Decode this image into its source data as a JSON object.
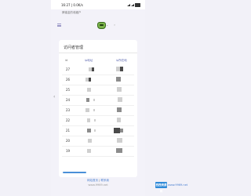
{
  "status": {
    "time": "16:27 | 0.0K/s"
  },
  "page": {
    "mini_title": "蜂蜜金的收藏户"
  },
  "card": {
    "title": "访问者管理",
    "columns": {
      "id": "id",
      "favorites": "ip地址",
      "visits": "ip所在地"
    }
  },
  "rows": [
    {
      "id": "27"
    },
    {
      "id": "26"
    },
    {
      "id": "25"
    },
    {
      "id": "24"
    },
    {
      "id": "23"
    },
    {
      "id": "22"
    },
    {
      "id": "21"
    },
    {
      "id": "20"
    },
    {
      "id": "19"
    }
  ],
  "footer": {
    "link1": "网站首页",
    "separator": " | ",
    "link2": "联系我",
    "url": "www.9969.net"
  },
  "watermark": {
    "badge": "西西资源网",
    "text": "www.9969.net"
  },
  "colors": {
    "accent": "#5b67b0",
    "link": "#4a7fd0",
    "background": "#f2f1f8"
  }
}
